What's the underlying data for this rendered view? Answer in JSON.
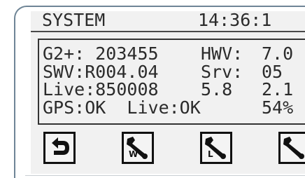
{
  "header": {
    "title": "SYSTEM",
    "time": "14:36:1"
  },
  "rows": [
    {
      "c1": "G2+: 203455",
      "c2": "HWV:",
      "c3": "7.0"
    },
    {
      "c1": "SWV:R004.04",
      "c2": "Srv:",
      "c3": "05"
    },
    {
      "c1": "Live:850008",
      "c2": "5.8",
      "c3": "2.1"
    },
    {
      "c1": "GPS:OK  Live:OK",
      "c2": "",
      "c3": "54%"
    }
  ],
  "softkeys": [
    {
      "icon": "back-arrow-icon",
      "letter": ""
    },
    {
      "icon": "wrench-icon",
      "letter": "W"
    },
    {
      "icon": "wrench-icon",
      "letter": "L"
    },
    {
      "icon": "wrench-icon",
      "letter": ""
    }
  ]
}
